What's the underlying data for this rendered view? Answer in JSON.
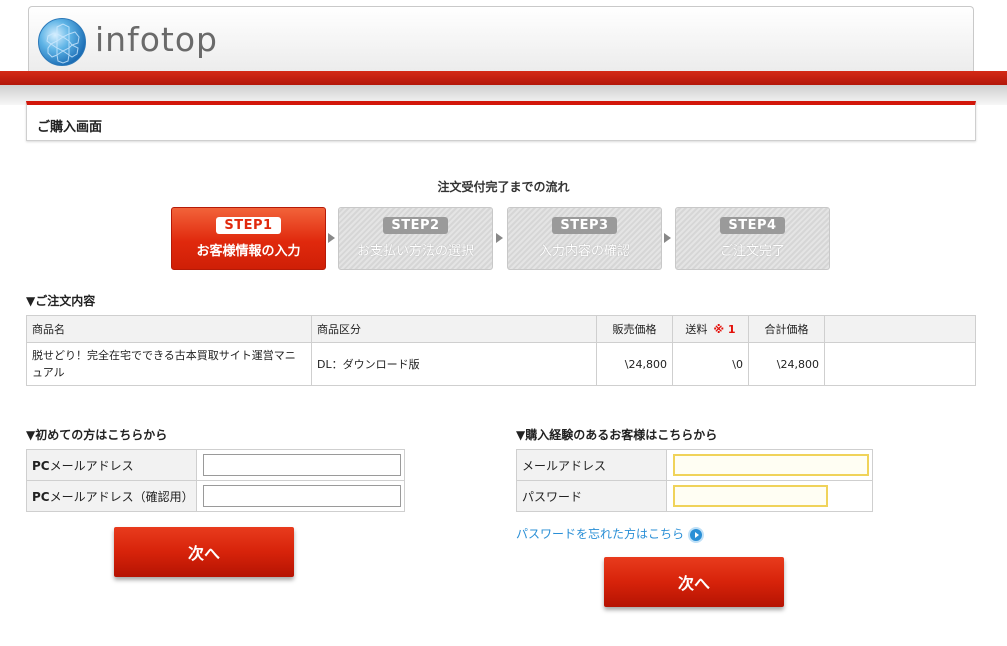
{
  "brand": {
    "logo_text": "infotop"
  },
  "page": {
    "title": "ご購入画面"
  },
  "flow": {
    "title": "注文受付完了までの流れ",
    "steps": [
      {
        "badge": "STEP1",
        "label": "お客様情報の入力"
      },
      {
        "badge": "STEP2",
        "label": "お支払い方法の選択"
      },
      {
        "badge": "STEP3",
        "label": "入力内容の確認"
      },
      {
        "badge": "STEP4",
        "label": "ご注文完了"
      }
    ]
  },
  "order": {
    "heading": "▼ご注文内容",
    "headers": {
      "product": "商品名",
      "category": "商品区分",
      "price": "販売価格",
      "shipping": "送料",
      "shipping_note": "※ 1",
      "total": "合計価格"
    },
    "row": {
      "product": "脱せどり！完全在宅でできる古本買取サイト運営マニュアル",
      "category": "DL：ダウンロード版",
      "price": "\\24,800",
      "shipping": "\\0",
      "total": "\\24,800"
    }
  },
  "new_customer": {
    "heading": "▼初めての方はこちらから",
    "email_label_prefix": "PC",
    "email_label": "メールアドレス",
    "confirm_label_prefix": "PC",
    "confirm_label": "メールアドレス（確認用）",
    "email_value": "",
    "confirm_value": "",
    "next_label": "次へ"
  },
  "returning_customer": {
    "heading": "▼購入経験のあるお客様はこちらから",
    "email_label": "メールアドレス",
    "password_label": "パスワード",
    "email_value": "",
    "password_value": "",
    "forgot_label": "パスワードを忘れた方はこちら",
    "next_label": "次へ"
  },
  "colors": {
    "accent_red": "#d7230a",
    "link_blue": "#2a8fd6",
    "highlight_yellow": "#f0d35a"
  }
}
